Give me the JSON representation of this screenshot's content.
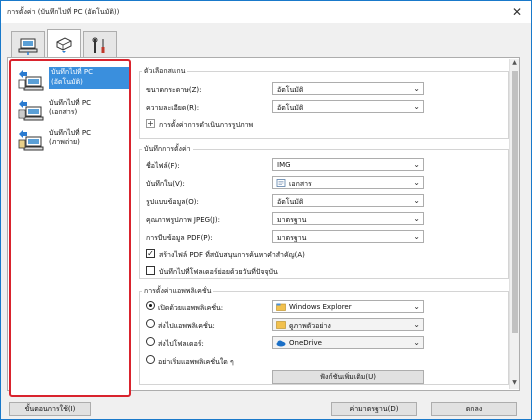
{
  "window": {
    "title": "การตั้งค่า (บันทึกไปที่ PC (อัตโนมัติ))",
    "close_glyph": "✕"
  },
  "tabs": [
    {
      "name": "scan-from-computer",
      "icon": "computer-scan-icon",
      "active": false
    },
    {
      "name": "scan-from-operation-panel",
      "icon": "scanner-icon",
      "active": true
    },
    {
      "name": "general-settings",
      "icon": "tools-icon",
      "active": false
    }
  ],
  "sidebar": {
    "items": [
      {
        "label_line1": "บันทึกไปที่ PC",
        "label_line2": "(อัตโนมัติ)",
        "icon": "save-auto-icon",
        "selected": true
      },
      {
        "label_line1": "บันทึกไปที่ PC",
        "label_line2": "(เอกสาร)",
        "icon": "save-document-icon",
        "selected": false
      },
      {
        "label_line1": "บันทึกไปที่ PC",
        "label_line2": "(ภาพถ่าย)",
        "icon": "save-photo-icon",
        "selected": false
      }
    ]
  },
  "scan_options": {
    "title": "ตัวเลือกสแกน",
    "paper_size": {
      "label": "ขนาดกระดาษ(Z):",
      "value": "อัตโนมัติ"
    },
    "resolution": {
      "label": "ความละเอียด(R):",
      "value": "อัตโนมัติ"
    },
    "image_processing": {
      "label": "การตั้งค่าการดำเนินการรูปภาพ",
      "toggle": "+"
    }
  },
  "save_settings": {
    "title": "บันทึกการตั้งค่า",
    "file_name": {
      "label": "ชื่อไฟล์(F):",
      "value": "IMG"
    },
    "save_in": {
      "label": "บันทึกใน(V):",
      "value": "เอกสาร",
      "icon": "folder-documents-icon"
    },
    "data_format": {
      "label": "รูปแบบข้อมูล(O):",
      "value": "อัตโนมัติ"
    },
    "jpeg_quality": {
      "label": "คุณภาพรูปภาพ JPEG(J):",
      "value": "มาตรฐาน"
    },
    "pdf_compression": {
      "label": "การบีบข้อมูล PDF(P):",
      "value": "มาตรฐาน"
    },
    "keyword_pdf": {
      "label": "สร้างไฟล์ PDF ที่สนับสนุนการค้นหาคำสำคัญ(A)",
      "checked": true,
      "check_glyph": "✓"
    },
    "subfolder": {
      "label": "บันทึกไปที่โฟลเดอร์ย่อยด้วยวันที่ปัจจุบัน",
      "checked": false
    }
  },
  "app_settings": {
    "title": "การตั้งค่าแอพพลิเคชั่น",
    "open_with": {
      "label": "เปิดด้วยแอพพลิเคชั่น:",
      "value": "Windows Explorer",
      "icon": "windows-explorer-icon",
      "selected": true
    },
    "send_to_app": {
      "label": "ส่งไปแอพพลิเคชั่น:",
      "value": "ดูภาพตัวอย่าง",
      "icon": "preview-icon",
      "selected": false
    },
    "send_to_folder": {
      "label": "ส่งไปโฟลเดอร์:",
      "value": "OneDrive",
      "icon": "onedrive-icon",
      "selected": false
    },
    "no_app": {
      "label": "อย่าเริ่มแอพพลิเคชั่นใด ๆ",
      "selected": false
    },
    "more_functions": {
      "label": "ฟังก์ชันเพิ่มเติม(U)"
    }
  },
  "footer": {
    "instructions": "ขั้นตอนการใช้(I)",
    "defaults": "ค่ามาตรฐาน(D)",
    "ok": "ตกลง"
  },
  "colors": {
    "highlight": "#d9232d",
    "selection": "#3a8fdd",
    "window_border": "#1979ca"
  }
}
